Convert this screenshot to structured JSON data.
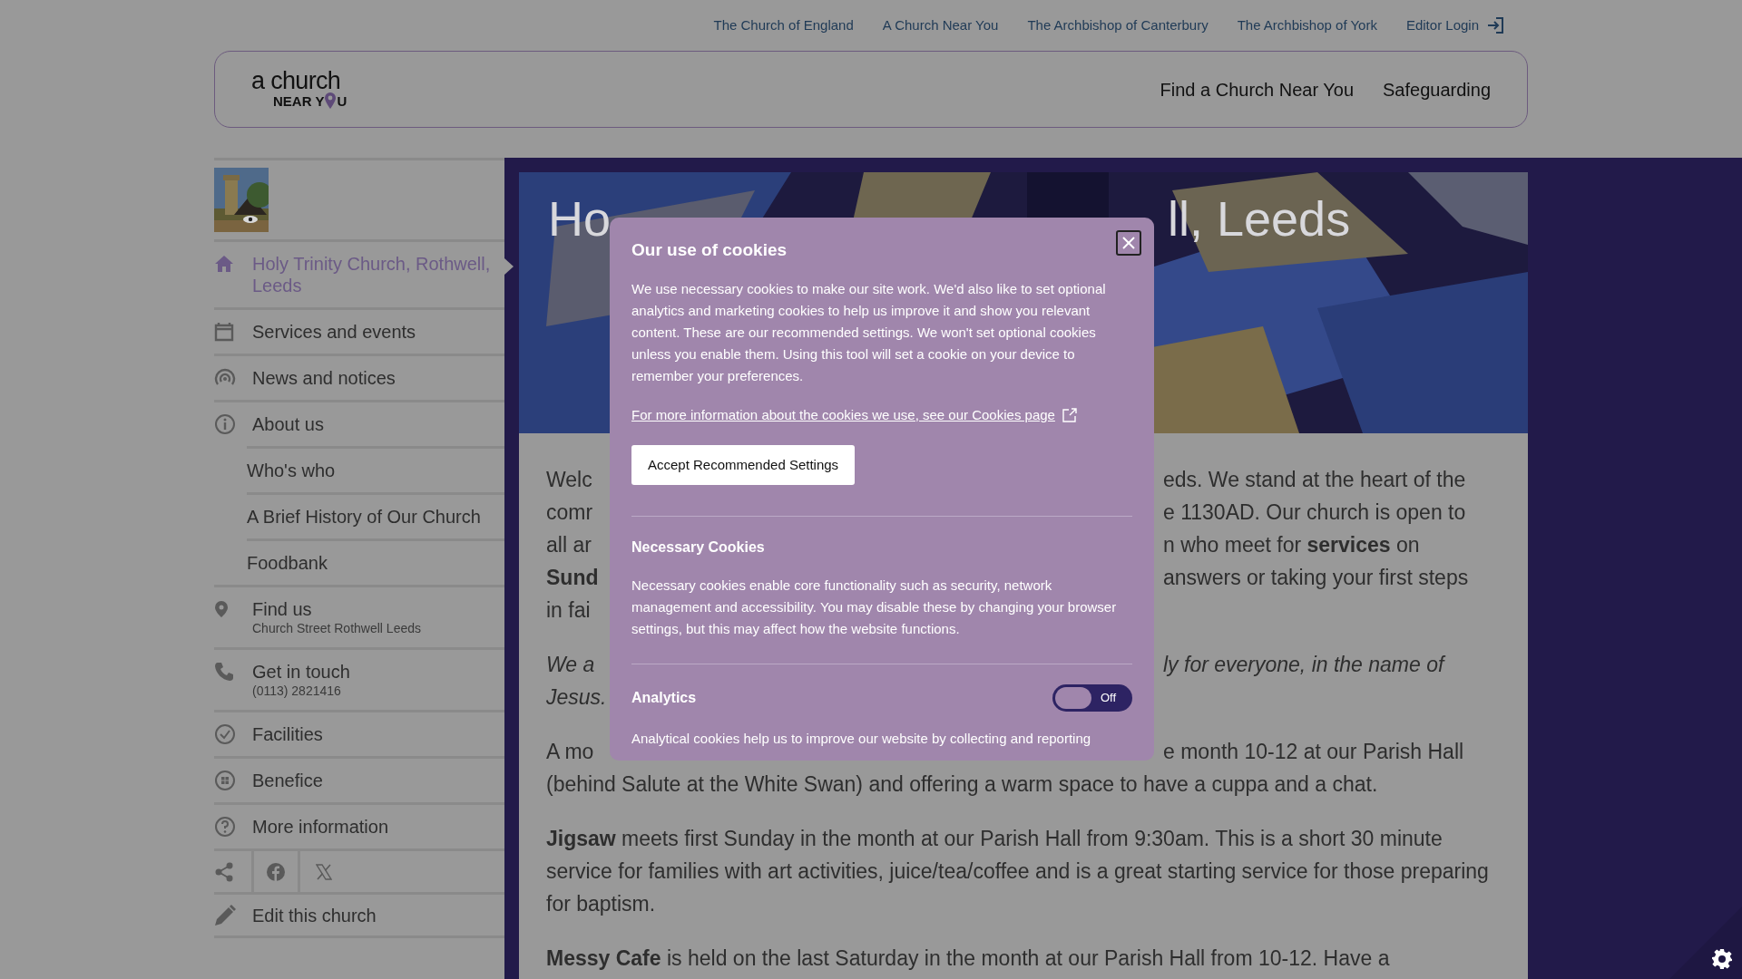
{
  "top_links": [
    {
      "label": "The Church of England"
    },
    {
      "label": "A Church Near You"
    },
    {
      "label": "The Archbishop of Canterbury"
    },
    {
      "label": "The Archbishop of York"
    },
    {
      "label": "Editor Login",
      "kind": "login"
    }
  ],
  "header": {
    "logo": {
      "top": "a church",
      "bottom_left": "NEAR Y",
      "bottom_right": "U"
    },
    "nav": [
      "Find a Church Near You",
      "Safeguarding"
    ]
  },
  "sidebar": {
    "items": [
      {
        "label": "Holy Trinity Church, Rothwell, Leeds",
        "kind": "main",
        "selected": true
      },
      {
        "label": "Services and events",
        "kind": "main",
        "selected": false
      },
      {
        "label": "News and notices",
        "kind": "main",
        "selected": false
      },
      {
        "label": "About us",
        "kind": "main",
        "selected": false
      },
      {
        "label": "Who's who",
        "kind": "sub",
        "selected": false
      },
      {
        "label": "A Brief History of Our Church",
        "kind": "sub",
        "selected": false
      },
      {
        "label": "Foodbank",
        "kind": "sub",
        "selected": false
      },
      {
        "label": "Find us",
        "kind": "main",
        "selected": false,
        "subtitle": "Church Street Rothwell Leeds"
      },
      {
        "label": "Get in touch",
        "kind": "main",
        "selected": false,
        "subtitle": "(0113) 2821416"
      },
      {
        "label": "Facilities",
        "kind": "main",
        "selected": false
      },
      {
        "label": "Benefice",
        "kind": "main",
        "selected": false
      },
      {
        "label": "More information",
        "kind": "main",
        "selected": false
      }
    ],
    "edit": "Edit this church"
  },
  "hero": {
    "title_left": "Ho",
    "title_right": "ll, Leeds"
  },
  "content": [
    {
      "kind": "text",
      "lines": [
        {
          "left": "Welc",
          "right": "eds. We stand at the heart of the"
        },
        {
          "left": "comr",
          "right": "e 1130AD. Our church is open to"
        },
        {
          "left": "all ar",
          "right": "n who meet for **services** on"
        },
        {
          "left": "**Sund**",
          "right": "answers or taking your first steps"
        },
        {
          "left": "in fai"
        }
      ]
    },
    {
      "kind": "quote",
      "lines": [
        {
          "left": "We a",
          "right": "ly for everyone,  in the name of"
        },
        {
          "left": "Jesus."
        }
      ]
    },
    {
      "kind": "text",
      "lines": [
        {
          "left": "A mo",
          "right": "e month 10-12 at our Parish Hall"
        }
      ],
      "text": "(behind Salute at the White Swan) and offering a warm space to have a cuppa and a chat."
    },
    {
      "kind": "text",
      "text": "**Jigsaw** meets first Sunday in the month at our Parish Hall from 9:30am. This is a short 30 minute service for families with art activities, juice/tea/coffee and is a great starting service for those preparing for baptism."
    },
    {
      "kind": "text",
      "text": "**Messy Cafe** is held on the last Saturday in the month at our Parish Hall from 10-12. Have a"
    }
  ],
  "cookie_dialog": {
    "title": "Our use of cookies",
    "body": "We use necessary cookies to make our site work. We'd also like to set optional analytics and marketing cookies to help us improve it and show you relevant content. These are our recommended settings. We won't set optional cookies unless you enable them. Using this tool will set a cookie on your device to remember your preferences.",
    "link": "For more information about the cookies we use, see our Cookies page",
    "button": "Accept Recommended Settings",
    "sections": [
      {
        "title": "Necessary Cookies",
        "text": "Necessary cookies enable core functionality such as security, network management and accessibility. You may disable these by changing your browser settings, but this may affect how the website functions."
      },
      {
        "title": "Analytics",
        "toggle": {
          "on": false,
          "label": "Off"
        },
        "text": "Analytical cookies help us to improve our website by collecting and reporting"
      }
    ]
  }
}
